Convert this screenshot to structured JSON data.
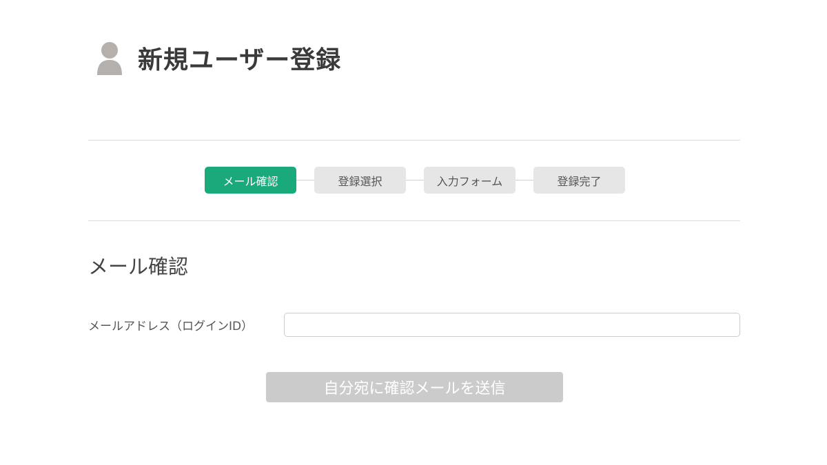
{
  "header": {
    "icon": "user-silhouette-icon",
    "title": "新規ユーザー登録"
  },
  "steps": [
    {
      "label": "メール確認",
      "active": true
    },
    {
      "label": "登録選択",
      "active": false
    },
    {
      "label": "入力フォーム",
      "active": false
    },
    {
      "label": "登録完了",
      "active": false
    }
  ],
  "section": {
    "title": "メール確認"
  },
  "form": {
    "email_label": "メールアドレス（ログインID）",
    "email_value": "",
    "email_placeholder": ""
  },
  "actions": {
    "send_label": "自分宛に確認メールを送信",
    "send_enabled": false
  },
  "colors": {
    "accent": "#19a97a",
    "step_inactive": "#e6e6e6",
    "button_disabled": "#cbcbcb",
    "icon": "#b5b0ac"
  }
}
